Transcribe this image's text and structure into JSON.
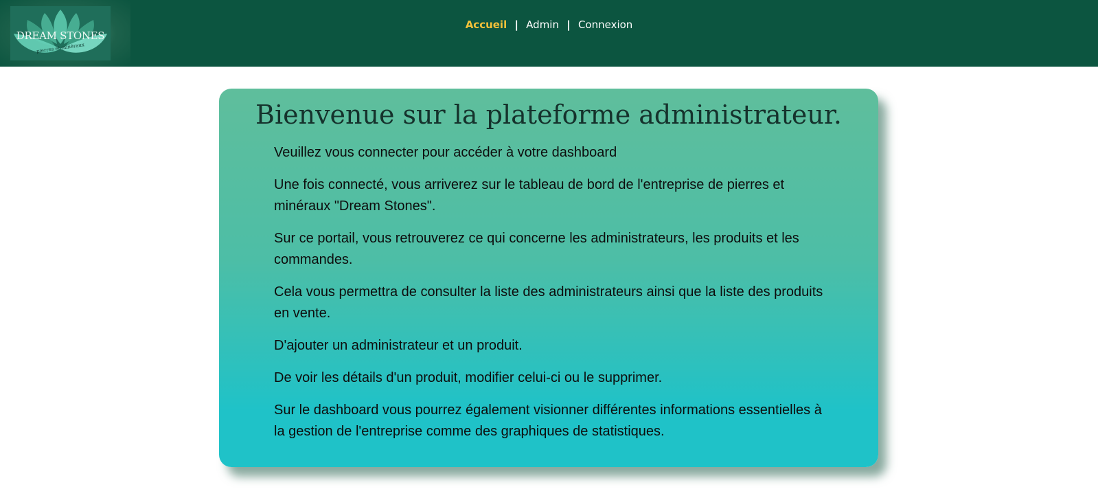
{
  "header": {
    "logo": {
      "title": "DREAM STONES",
      "subtitle": "pierres et minéraux"
    },
    "nav": {
      "home": "Accueil",
      "separator": "|",
      "admin": "Admin",
      "login": "Connexion"
    },
    "colors": {
      "background": "#0c5540",
      "active_link": "#f2c13a"
    }
  },
  "main": {
    "title": "Bienvenue sur la plateforme administrateur.",
    "paragraphs": [
      "Veuillez vous connecter pour accéder à votre dashboard",
      "Une fois connecté, vous arriverez sur le tableau de bord de l'entreprise de pierres et minéraux \"Dream Stones\".",
      "Sur ce portail, vous retrouverez ce qui concerne les administrateurs, les produits et les commandes.",
      "Cela vous permettra de consulter la liste des administrateurs ainsi que la liste des produits en vente.",
      "D'ajouter un administrateur et un produit.",
      "De voir les détails d'un produit, modifier celui-ci ou le supprimer.",
      "Sur le dashboard vous pourrez également visionner différentes informations essentielles à la gestion de l'entreprise comme des graphiques de statistiques."
    ]
  }
}
